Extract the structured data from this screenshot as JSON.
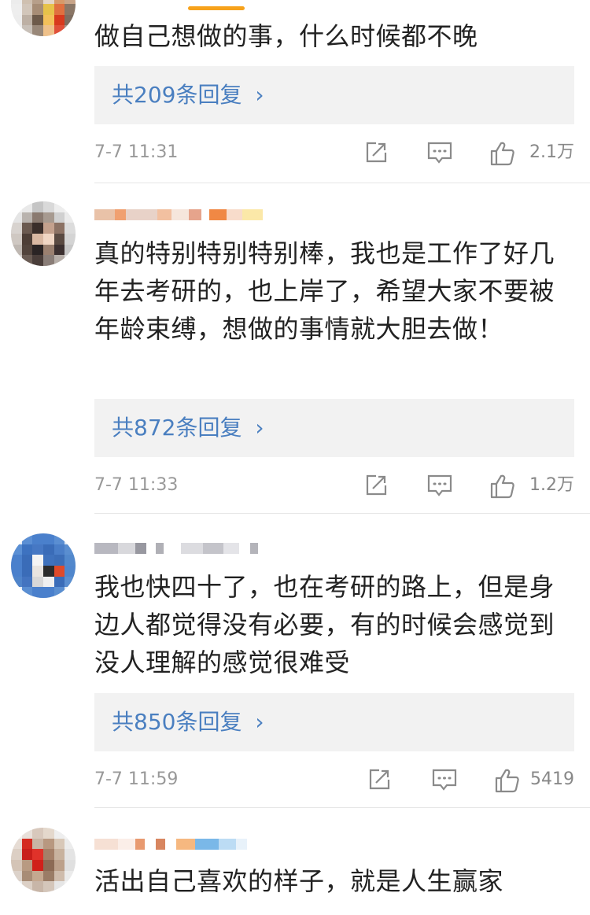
{
  "comments": [
    {
      "text": "做自己想做的事，什么时候都不晚",
      "reply_label": "共209条回复",
      "reply_arrow": "›",
      "time": "7-7 11:31",
      "likes": "2.1万"
    },
    {
      "text": "真的特别特别特别棒，我也是工作了好几年去考研的，也上岸了，希望大家不要被年龄束缚，想做的事情就大胆去做！",
      "reply_label": "共872条回复",
      "reply_arrow": "›",
      "time": "7-7 11:33",
      "likes": "1.2万"
    },
    {
      "text": "我也快四十了，也在考研的路上，但是身边人都觉得没有必要，有的时候会感觉到没人理解的感觉很难受",
      "reply_label": "共850条回复",
      "reply_arrow": "›",
      "time": "7-7 11:59",
      "likes": "5419"
    },
    {
      "text": "活出自己喜欢的样子，就是人生赢家"
    }
  ],
  "colors": {
    "accent": "#f7a21b",
    "link": "#4a7fc0",
    "meta": "#999999"
  },
  "icons": {
    "share": "share-icon",
    "comment": "comment-icon",
    "like": "thumbs-up-icon"
  }
}
